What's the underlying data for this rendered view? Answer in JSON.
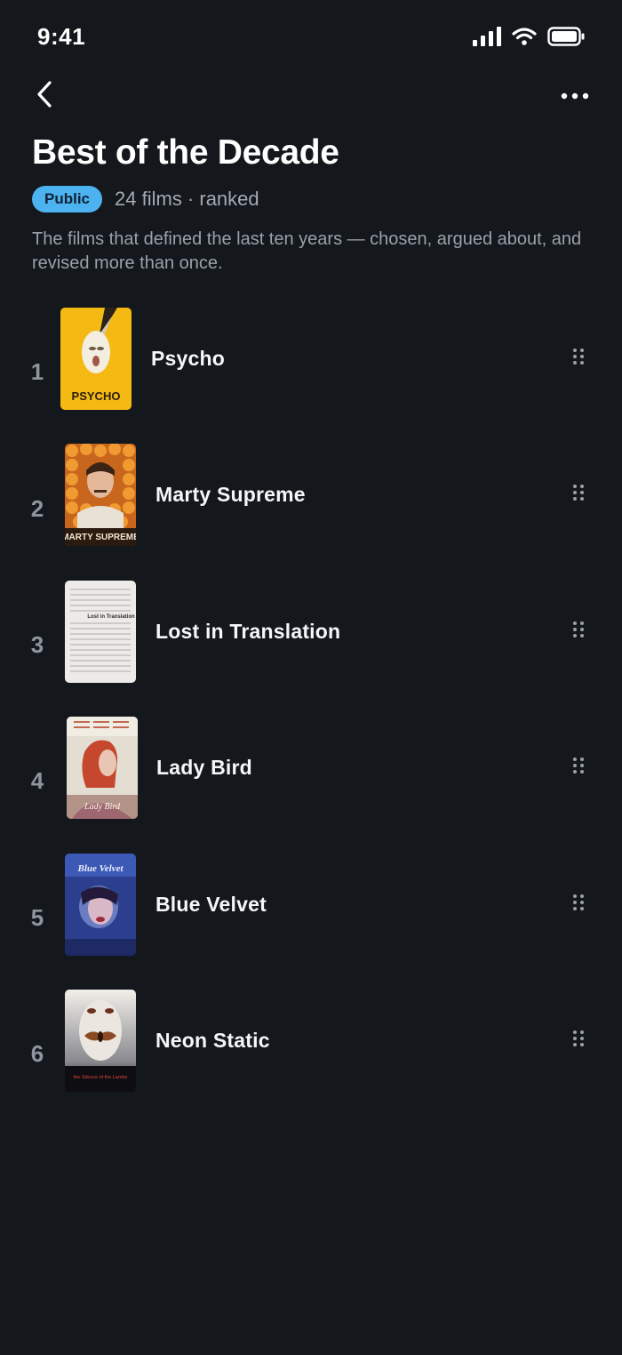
{
  "status_bar": {
    "time": "9:41"
  },
  "nav": {
    "back_icon": "chevron-left-icon",
    "more_icon": "ellipsis-icon"
  },
  "header": {
    "title": "Best of the Decade",
    "badge": "Public",
    "meta": "24 films · ranked",
    "description": "The films that defined the last ten years — chosen, argued about, and revised more than once."
  },
  "films": [
    {
      "rank": "1",
      "title": "Psycho",
      "poster_text": "PSYCHO"
    },
    {
      "rank": "2",
      "title": "Marty Supreme",
      "poster_text": "MARTY SUPREME"
    },
    {
      "rank": "3",
      "title": "Lost in Translation",
      "poster_text": "Lost in Translation"
    },
    {
      "rank": "4",
      "title": "Lady Bird",
      "poster_text": "Lady Bird"
    },
    {
      "rank": "5",
      "title": "Blue Velvet",
      "poster_text": "Blue Velvet"
    },
    {
      "rank": "6",
      "title": "Neon Static",
      "poster_text": "the Silence of the Lambs"
    }
  ],
  "colors": {
    "background": "#14171c",
    "badge": "#4db3f0",
    "text_primary": "#f5f6f8",
    "text_secondary": "#9aa1ab"
  }
}
